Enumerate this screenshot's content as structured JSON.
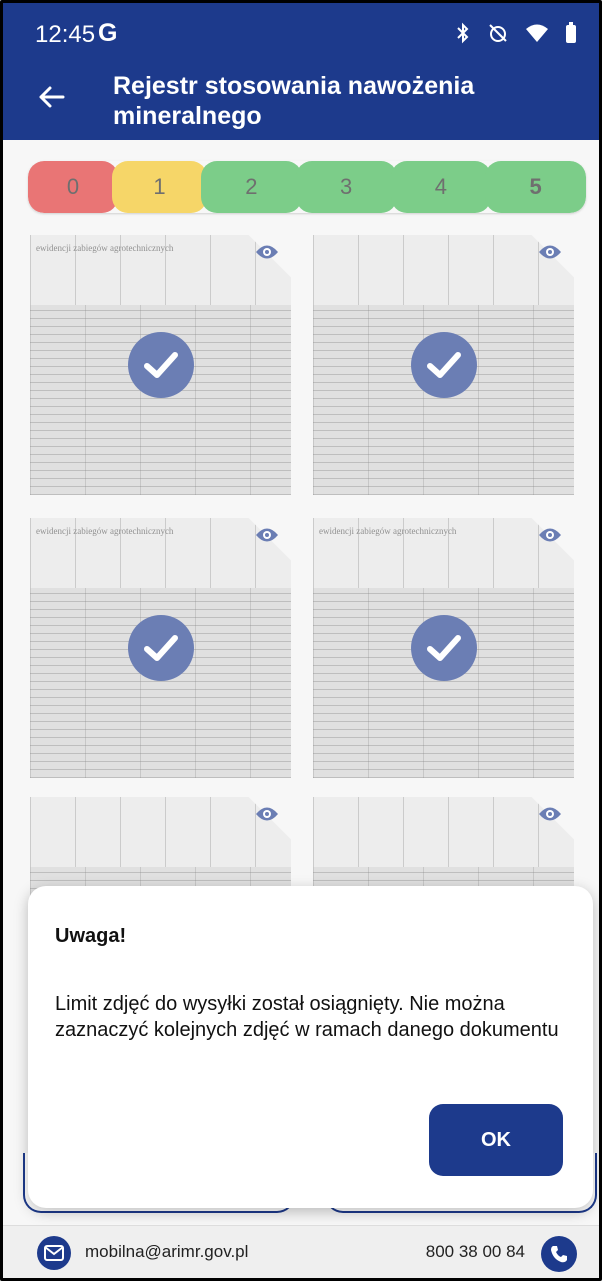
{
  "status_bar": {
    "time": "12:45",
    "g_label": "G"
  },
  "app_bar": {
    "title": "Rejestr stosowania nawożenia mineralnego"
  },
  "rating": {
    "items": [
      "0",
      "1",
      "2",
      "3",
      "4",
      "5"
    ],
    "selected": "5",
    "colors": {
      "red": "#de2c2c",
      "yellow": "#f2c118",
      "green": "#36b24a"
    }
  },
  "thumbnails": {
    "header_text": "ewidencji zabiegów agrotechnicznych",
    "items": [
      {
        "selected": true
      },
      {
        "selected": true
      },
      {
        "selected": true
      },
      {
        "selected": true
      },
      {
        "selected": false
      },
      {
        "selected": false
      }
    ]
  },
  "dialog": {
    "title": "Uwaga!",
    "message": "Limit zdjęć do wysyłki został osiągnięty. Nie można zaznaczyć kolejnych zdjęć w ramach danego dokumentu",
    "ok_label": "OK"
  },
  "footer": {
    "email": "mobilna@arimr.gov.pl",
    "phone": "800 38 00 84"
  },
  "theme": {
    "primary": "#1d3a8c"
  }
}
